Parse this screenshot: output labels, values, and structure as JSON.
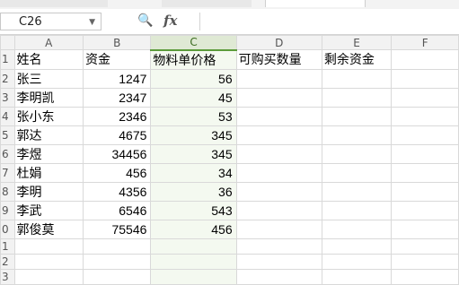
{
  "namebox": {
    "value": "C26"
  },
  "formula_bar": {
    "value": ""
  },
  "columns": [
    "A",
    "B",
    "C",
    "D",
    "E",
    "F"
  ],
  "selected_column": "C",
  "rows": [
    {
      "num": "1",
      "cells": [
        "姓名",
        "资金",
        "物料单价格",
        "可购买数量",
        "剩余资金",
        ""
      ]
    },
    {
      "num": "2",
      "cells": [
        "张三",
        "1247",
        "56",
        "",
        "",
        ""
      ]
    },
    {
      "num": "3",
      "cells": [
        "李明凯",
        "2347",
        "45",
        "",
        "",
        ""
      ]
    },
    {
      "num": "4",
      "cells": [
        "张小东",
        "2346",
        "53",
        "",
        "",
        ""
      ]
    },
    {
      "num": "5",
      "cells": [
        "郭达",
        "4675",
        "345",
        "",
        "",
        ""
      ]
    },
    {
      "num": "6",
      "cells": [
        "李煜",
        "34456",
        "345",
        "",
        "",
        ""
      ]
    },
    {
      "num": "7",
      "cells": [
        "杜娟",
        "456",
        "34",
        "",
        "",
        ""
      ]
    },
    {
      "num": "8",
      "cells": [
        "李明",
        "4356",
        "36",
        "",
        "",
        ""
      ]
    },
    {
      "num": "9",
      "cells": [
        "李武",
        "6546",
        "543",
        "",
        "",
        ""
      ]
    },
    {
      "num": "0",
      "cells": [
        "郭俊莫",
        "75546",
        "456",
        "",
        "",
        ""
      ]
    },
    {
      "num": "1",
      "cells": [
        "",
        "",
        "",
        "",
        "",
        ""
      ]
    },
    {
      "num": "2",
      "cells": [
        "",
        "",
        "",
        "",
        "",
        ""
      ]
    },
    {
      "num": "3",
      "cells": [
        "",
        "",
        "",
        "",
        "",
        ""
      ]
    }
  ]
}
